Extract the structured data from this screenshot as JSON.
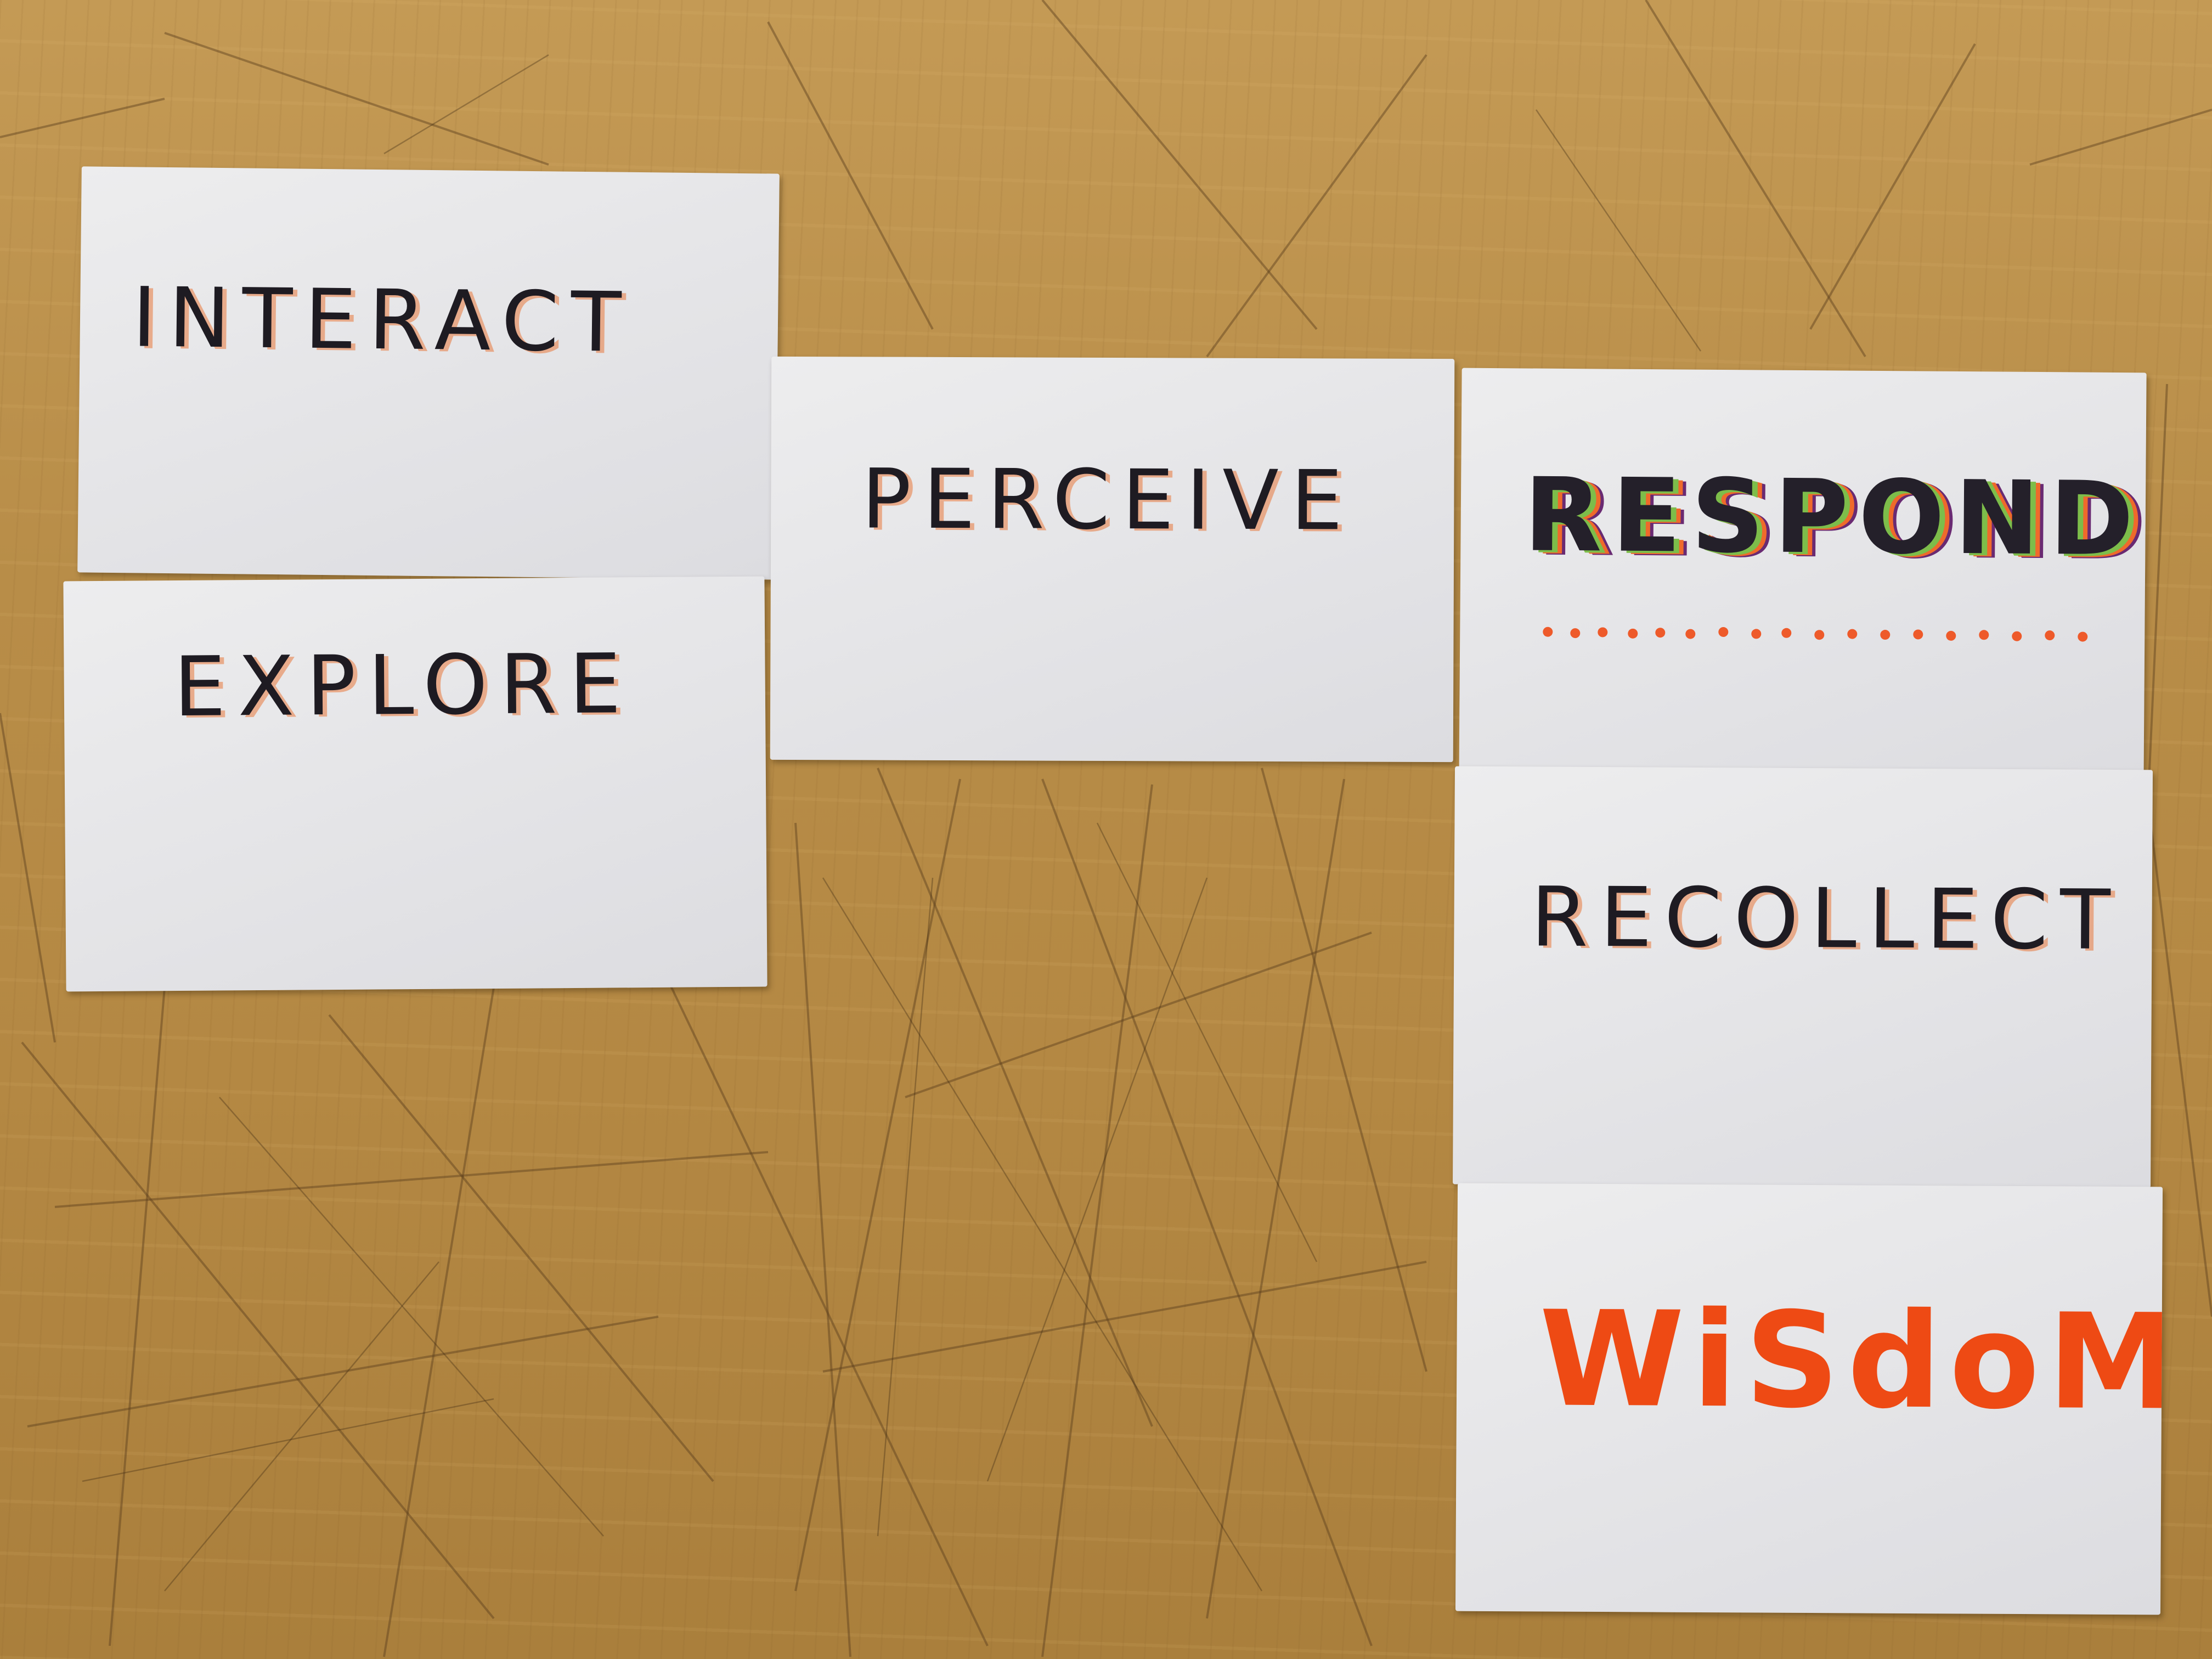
{
  "cards": {
    "interact": {
      "word": "INTERACT"
    },
    "explore": {
      "word": "EXPLORE"
    },
    "perceive": {
      "word": "PERCEIVE"
    },
    "respond": {
      "word": "RESPOND",
      "dot_color": "#ee5a2a"
    },
    "recollect": {
      "word": "RECOLLECT"
    },
    "wisdom": {
      "word": "WiSdoM"
    }
  },
  "colors": {
    "table": "#b68b45",
    "card": "#e6e6e8",
    "ink_black": "#1e1b22",
    "ink_orange": "#ee4a14",
    "ink_green": "#7dbd4a",
    "ink_purple": "#6a2a72"
  }
}
